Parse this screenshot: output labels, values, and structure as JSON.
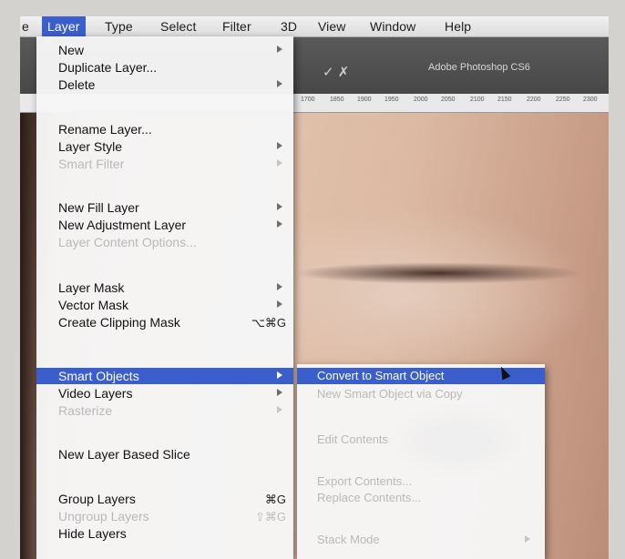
{
  "menubar": {
    "items": [
      "e",
      "Layer",
      "Type",
      "Select",
      "Filter",
      "3D",
      "View",
      "Window",
      "Help"
    ]
  },
  "app": {
    "title": "Adobe Photoshop CS6"
  },
  "ruler": {
    "ticks": [
      "1700",
      "1850",
      "1900",
      "1950",
      "2000",
      "2050",
      "2100",
      "2150",
      "2200",
      "2250",
      "2300"
    ]
  },
  "layer_menu": {
    "items": [
      {
        "label": "New",
        "submenu": true,
        "enabled": true
      },
      {
        "label": "Duplicate Layer...",
        "enabled": true
      },
      {
        "label": "Delete",
        "submenu": true,
        "enabled": true
      },
      {
        "label": "Rename Layer...",
        "enabled": true
      },
      {
        "label": "Layer Style",
        "submenu": true,
        "enabled": true
      },
      {
        "label": "Smart Filter",
        "submenu": true,
        "enabled": false
      },
      {
        "label": "New Fill Layer",
        "submenu": true,
        "enabled": true
      },
      {
        "label": "New Adjustment Layer",
        "submenu": true,
        "enabled": true
      },
      {
        "label": "Layer Content Options...",
        "enabled": false
      },
      {
        "label": "Layer Mask",
        "submenu": true,
        "enabled": true
      },
      {
        "label": "Vector Mask",
        "submenu": true,
        "enabled": true
      },
      {
        "label": "Create Clipping Mask",
        "shortcut": "⌥⌘G",
        "enabled": true
      },
      {
        "label": "Smart Objects",
        "submenu": true,
        "enabled": true,
        "selected": true
      },
      {
        "label": "Video Layers",
        "submenu": true,
        "enabled": true
      },
      {
        "label": "Rasterize",
        "submenu": true,
        "enabled": false
      },
      {
        "label": "New Layer Based Slice",
        "enabled": true
      },
      {
        "label": "Group Layers",
        "shortcut": "⌘G",
        "enabled": true
      },
      {
        "label": "Ungroup Layers",
        "shortcut": "⇧⌘G",
        "enabled": false
      },
      {
        "label": "Hide Layers",
        "enabled": true
      }
    ]
  },
  "smart_objects_submenu": {
    "items": [
      {
        "label": "Convert to Smart Object",
        "enabled": true,
        "selected": true
      },
      {
        "label": "New Smart Object via Copy",
        "enabled": false
      },
      {
        "label": "Edit Contents",
        "enabled": false
      },
      {
        "label": "Export Contents...",
        "enabled": false
      },
      {
        "label": "Replace Contents...",
        "enabled": false
      },
      {
        "label": "Stack Mode",
        "submenu": true,
        "enabled": false
      }
    ]
  },
  "icons": [
    "submenu-arrow-icon",
    "cursor-arrow-icon",
    "tool-icon"
  ],
  "colors": {
    "highlight": "#3a5fcd",
    "menu_bg": "#f6f6f6",
    "disabled_text": "#b9b9b9"
  }
}
